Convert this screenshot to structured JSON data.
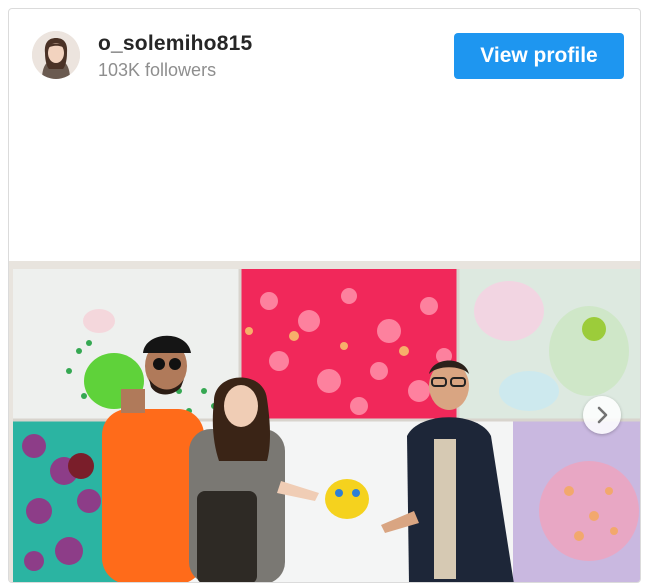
{
  "profile": {
    "username": "o_solemiho815",
    "followers": "103K followers",
    "view_profile_label": "View profile"
  },
  "colors": {
    "accent": "#1e96f0",
    "username": "#262626",
    "muted": "#8e8e8e"
  },
  "icons": {
    "next": "chevron-right-icon"
  },
  "photo": {
    "carousel_has_next": true
  }
}
